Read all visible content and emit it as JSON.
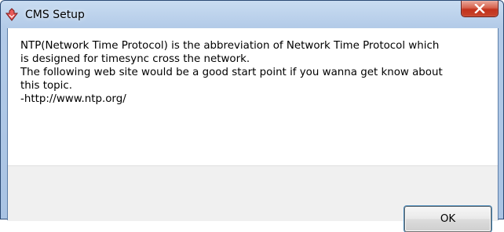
{
  "window": {
    "title": "CMS Setup",
    "icon": "cms-setup-app-icon",
    "close_icon": "close-icon",
    "close_color": "#c8452d"
  },
  "message": {
    "lines": [
      "NTP(Network Time Protocol) is the abbreviation of Network Time Protocol which",
      "is designed for timesync cross the network.",
      "The following web site would be a good start point if you wanna get know about",
      "this topic.",
      "-http://www.ntp.org/"
    ]
  },
  "buttons": {
    "ok_label": "OK"
  }
}
